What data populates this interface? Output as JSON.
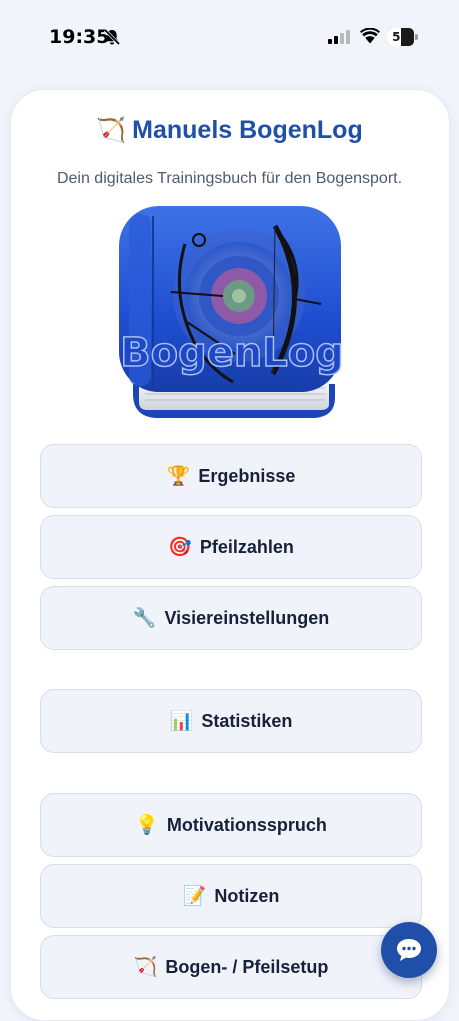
{
  "status_bar": {
    "time": "19:35",
    "battery_level": "53",
    "battery_fraction": 0.53
  },
  "header": {
    "title": "Manuels BogenLog",
    "title_icon": "🏹",
    "subtitle": "Dein digitales Trainingsbuch für den Bogensport.",
    "logo_text": "BogenLog"
  },
  "menu": {
    "groups": [
      {
        "items": [
          {
            "emoji": "🏆",
            "label": "Ergebnisse"
          },
          {
            "emoji": "🎯",
            "label": "Pfeilzahlen"
          },
          {
            "emoji": "🔧",
            "label": "Visiereinstellungen"
          }
        ]
      },
      {
        "items": [
          {
            "emoji": "📊",
            "label": "Statistiken"
          }
        ]
      },
      {
        "items": [
          {
            "emoji": "💡",
            "label": "Motivationsspruch"
          },
          {
            "emoji": "📝",
            "label": "Notizen"
          },
          {
            "emoji": "🏹",
            "label": "Bogen- / Pfeilsetup"
          }
        ]
      }
    ]
  },
  "colors": {
    "accent": "#1f4fa8",
    "background": "#f1f4fa",
    "button_bg": "#f0f3f9",
    "text_dark": "#18213a"
  },
  "icons": {
    "status": [
      "bell-slash-icon",
      "signal-icon",
      "wifi-icon",
      "battery-icon"
    ],
    "fab": "chat-bubble-icon"
  }
}
